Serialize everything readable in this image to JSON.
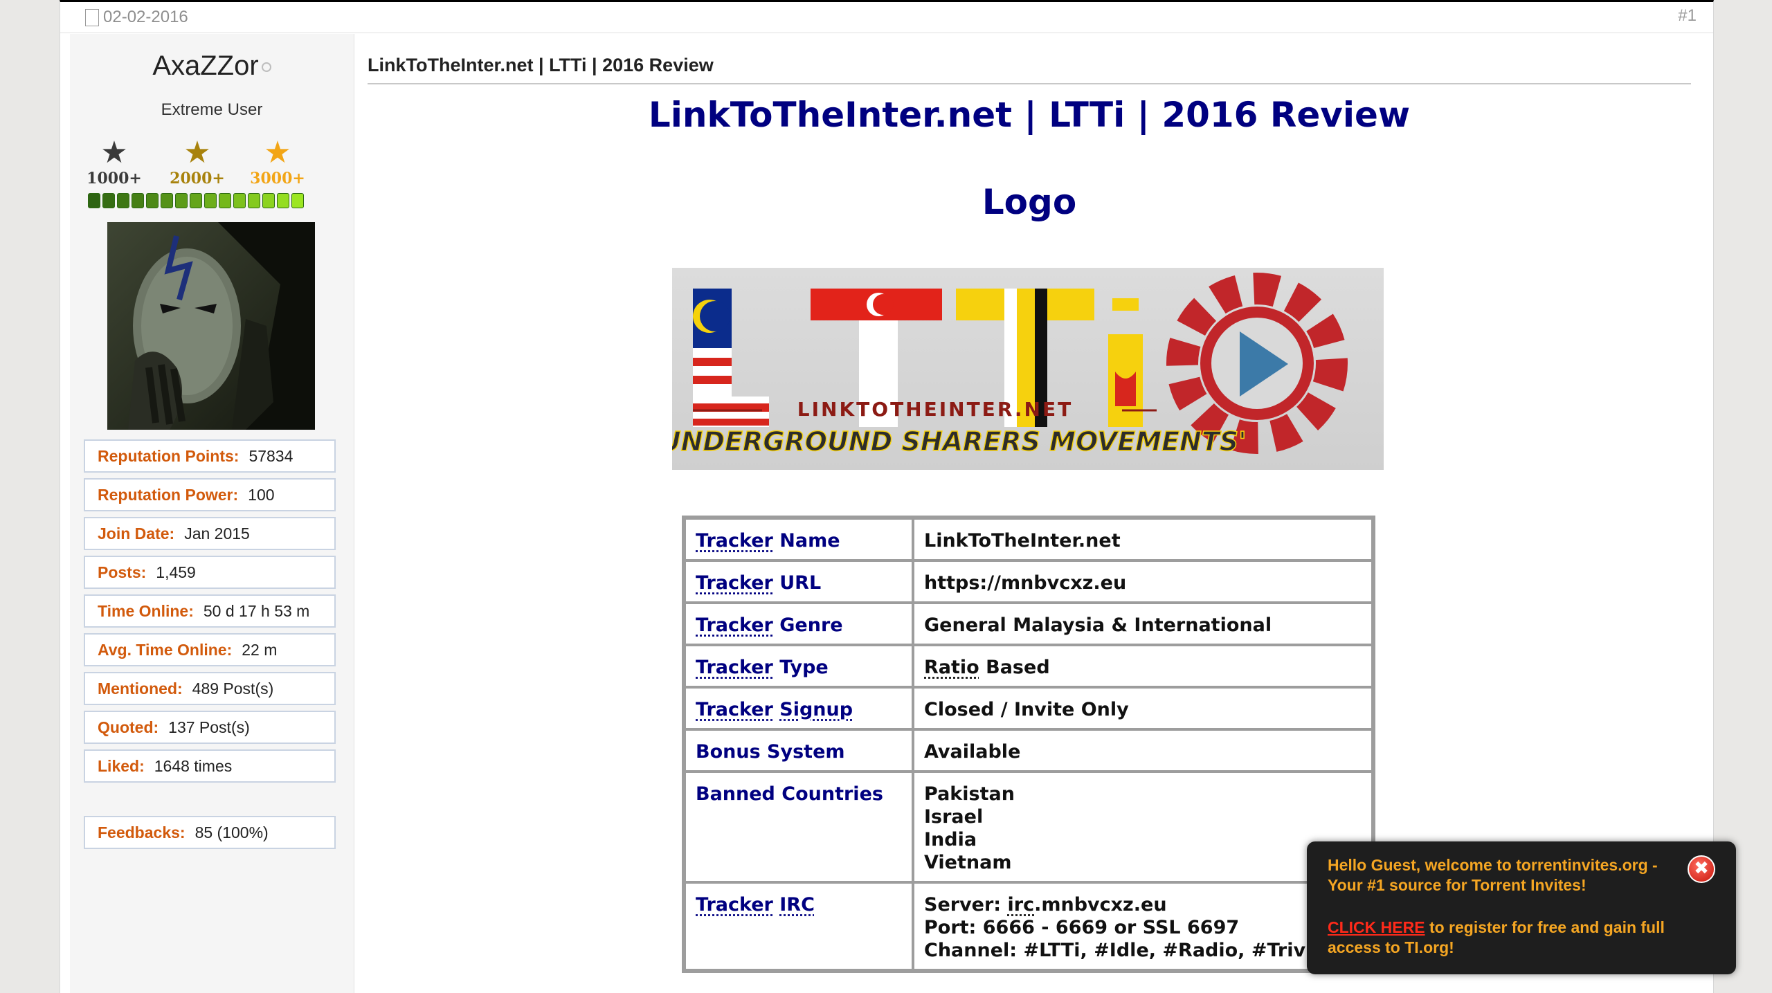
{
  "post": {
    "date": "02-02-2016",
    "number": "#1"
  },
  "user": {
    "name": "AxaZZor",
    "title": "Extreme User",
    "badges": [
      {
        "label": "1000+",
        "icon": "star-dark-icon",
        "color": "#3a3a3a"
      },
      {
        "label": "2000+",
        "icon": "star-bronze-icon",
        "color": "#a8820c"
      },
      {
        "label": "3000+",
        "icon": "star-gold-icon",
        "color": "#f2a516"
      }
    ],
    "reputation_pips": 15,
    "stats": [
      {
        "key": "Reputation Points:",
        "value": "57834"
      },
      {
        "key": "Reputation Power:",
        "value": "100"
      },
      {
        "key": "Join Date:",
        "value": "Jan 2015"
      },
      {
        "key": "Posts:",
        "value": "1,459"
      },
      {
        "key": "Time Online:",
        "value": "50 d 17 h 53 m"
      },
      {
        "key": "Avg. Time Online:",
        "value": "22 m"
      },
      {
        "key": "Mentioned:",
        "value": "489 Post(s)"
      },
      {
        "key": "Quoted:",
        "value": "137 Post(s)"
      },
      {
        "key": "Liked:",
        "value": "1648 times"
      }
    ],
    "feedback": {
      "key": "Feedbacks:",
      "value": "85 (100%)"
    }
  },
  "content": {
    "title": "LinkToTheInter.net | LTTi | 2016 Review",
    "heading": "LinkToTheInter.net | LTTi | 2016 Review",
    "logo_heading": "Logo",
    "logo": {
      "letters": [
        "L",
        "T",
        "T",
        "i"
      ],
      "site_text": "LINKTOTHEINTER.NET",
      "slogan": "'UNDERGROUND SHARERS MOVEMENTS'"
    },
    "table": {
      "tracker_name": {
        "label_a": "Tracker",
        "label_b": " Name",
        "value": "LinkToTheInter.net"
      },
      "tracker_url": {
        "label_a": "Tracker",
        "label_b": " URL",
        "value": "https://mnbvcxz.eu"
      },
      "tracker_genre": {
        "label_a": "Tracker",
        "label_b": " Genre",
        "value": "General Malaysia & International"
      },
      "tracker_type": {
        "label_a": "Tracker",
        "label_b": " Type",
        "value_a": "Ratio",
        "value_b": " Based"
      },
      "tracker_signup": {
        "label_a": "Tracker",
        "label_b": "Signup",
        "value": "Closed / Invite Only"
      },
      "bonus_system": {
        "label": "Bonus System",
        "value": "Available"
      },
      "banned_countries": {
        "label": "Banned Countries",
        "values": [
          "Pakistan",
          "Israel",
          "India",
          "Vietnam"
        ]
      },
      "tracker_irc": {
        "label_a": "Tracker",
        "label_b": "IRC",
        "server_a": "Server: ",
        "server_b": "irc",
        "server_c": ".mnbvcxz.eu",
        "port": "Port: 6666 - 6669 or SSL 6697",
        "channel": "Channel: #LTTi, #Idle, #Radio, #Trivia"
      }
    }
  },
  "popup": {
    "message": "Hello Guest, welcome to torrentinvites.org - Your #1 source for Torrent Invites!",
    "link_text": "CLICK HERE",
    "cta_rest": " to register for free and gain full access to TI.org!",
    "close_glyph": "✖"
  },
  "colors": {
    "label_orange": "#d25a0c",
    "heading_navy": "#000080",
    "popup_text": "#f5a623",
    "popup_link": "#ff2a1a"
  }
}
